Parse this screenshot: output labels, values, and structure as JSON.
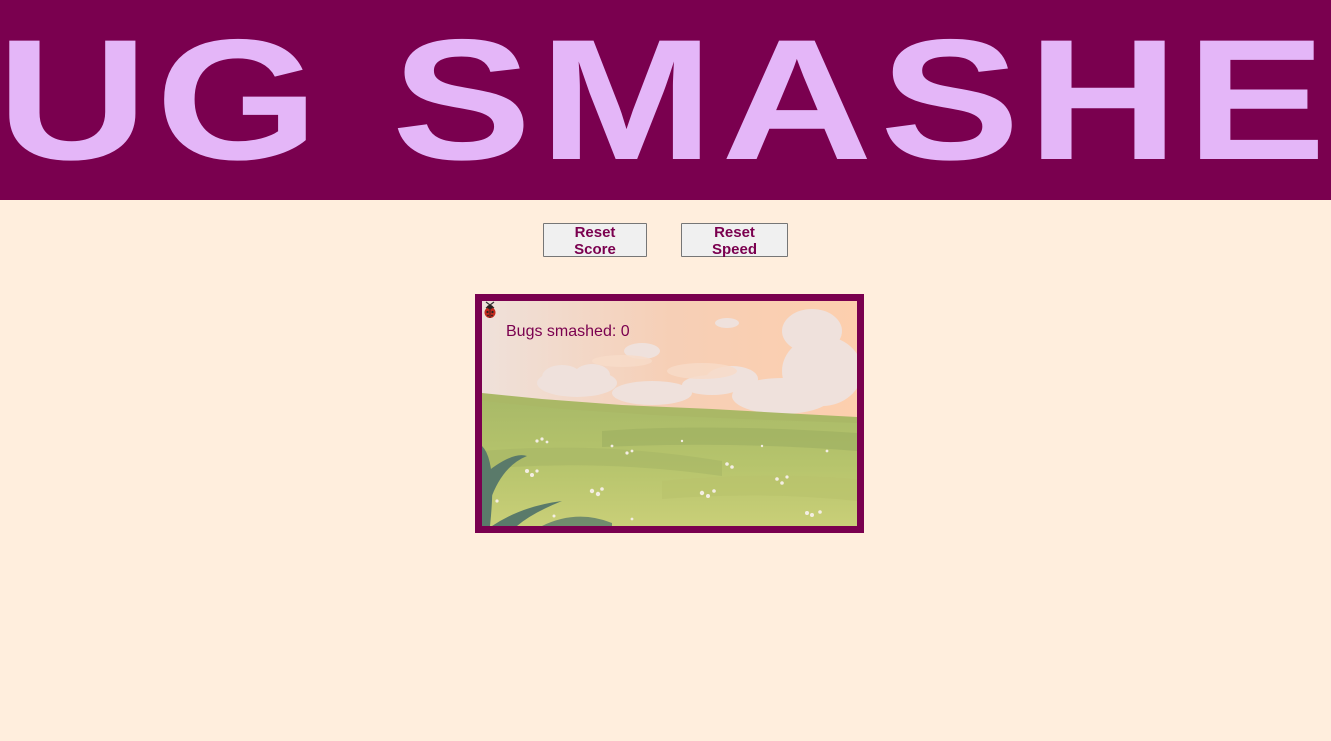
{
  "header": {
    "title": "BUG SMASHER"
  },
  "controls": {
    "reset_score_label": "Reset Score",
    "reset_speed_label": "Reset Speed"
  },
  "game": {
    "score_label": "Bugs smashed:",
    "score_value": "0",
    "sprite": "ladybug-icon",
    "background": "meadow-with-clouds"
  },
  "colors": {
    "brand": "#7a004f",
    "title": "#e4b6f8",
    "page_background": "#ffeedd",
    "button_background": "#f0f0f0"
  }
}
